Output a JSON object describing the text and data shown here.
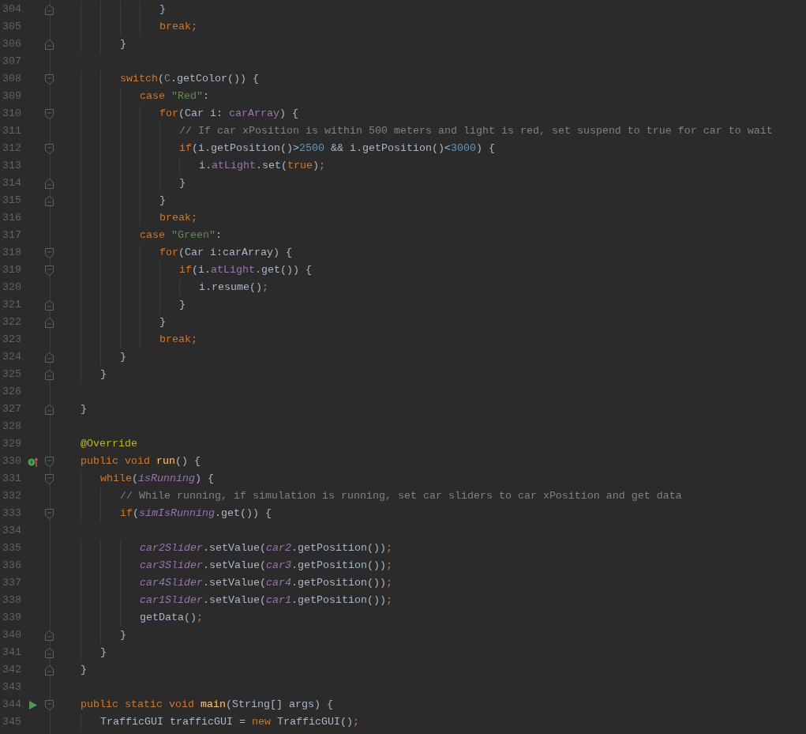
{
  "editor": {
    "lines": [
      {
        "number": "304",
        "fold": {
          "kind": "end"
        },
        "tokens": [
          {
            "kind": "plain",
            "text": "                    }"
          }
        ]
      },
      {
        "number": "305",
        "tokens": [
          {
            "kind": "kw",
            "text": "                    break;"
          }
        ]
      },
      {
        "number": "306",
        "fold": {
          "kind": "end"
        },
        "tokens": [
          {
            "kind": "plain",
            "text": "            }"
          }
        ]
      },
      {
        "number": "307"
      },
      {
        "number": "308",
        "fold": {
          "kind": "start"
        },
        "tokens": [
          {
            "kind": "kw",
            "text": "            switch"
          },
          {
            "kind": "plain",
            "text": "("
          },
          {
            "kind": "field",
            "text": "C"
          },
          {
            "kind": "plain",
            "text": ".getColor()) {"
          }
        ]
      },
      {
        "number": "309",
        "tokens": [
          {
            "kind": "kw",
            "text": "                case "
          },
          {
            "kind": "str",
            "text": "\"Red\""
          },
          {
            "kind": "plain",
            "text": ":"
          }
        ]
      },
      {
        "number": "310",
        "fold": {
          "kind": "start"
        },
        "tokens": [
          {
            "kind": "kw",
            "text": "                    for"
          },
          {
            "kind": "plain",
            "text": "(Car i: "
          },
          {
            "kind": "field",
            "text": "carArray"
          },
          {
            "kind": "plain",
            "text": ") {"
          }
        ]
      },
      {
        "number": "311",
        "tokens": [
          {
            "kind": "comment",
            "text": "                        // If car xPosition is within 500 meters and light is red, set suspend to true for car to wait"
          }
        ]
      },
      {
        "number": "312",
        "fold": {
          "kind": "start"
        },
        "tokens": [
          {
            "kind": "kw",
            "text": "                        if"
          },
          {
            "kind": "plain",
            "text": "(i.getPosition()>"
          },
          {
            "kind": "num",
            "text": "2500"
          },
          {
            "kind": "plain",
            "text": " && i.getPosition()<"
          },
          {
            "kind": "num",
            "text": "3000"
          },
          {
            "kind": "plain",
            "text": ") {"
          }
        ]
      },
      {
        "number": "313",
        "tokens": [
          {
            "kind": "plain",
            "text": "                            i."
          },
          {
            "kind": "field",
            "text": "atLight"
          },
          {
            "kind": "plain",
            "text": ".set("
          },
          {
            "kind": "kw",
            "text": "true"
          },
          {
            "kind": "plain",
            "text": ")"
          },
          {
            "kind": "kw",
            "text": ";"
          }
        ]
      },
      {
        "number": "314",
        "fold": {
          "kind": "end"
        },
        "tokens": [
          {
            "kind": "plain",
            "text": "                        }"
          }
        ]
      },
      {
        "number": "315",
        "fold": {
          "kind": "end"
        },
        "tokens": [
          {
            "kind": "plain",
            "text": "                    }"
          }
        ]
      },
      {
        "number": "316",
        "tokens": [
          {
            "kind": "kw",
            "text": "                    break;"
          }
        ]
      },
      {
        "number": "317",
        "tokens": [
          {
            "kind": "kw",
            "text": "                case "
          },
          {
            "kind": "str",
            "text": "\"Green\""
          },
          {
            "kind": "plain",
            "text": ":"
          }
        ]
      },
      {
        "number": "318",
        "fold": {
          "kind": "start"
        },
        "tokens": [
          {
            "kind": "kw",
            "text": "                    for"
          },
          {
            "kind": "plain",
            "text": "(Car i:carArray) {"
          }
        ]
      },
      {
        "number": "319",
        "fold": {
          "kind": "start"
        },
        "tokens": [
          {
            "kind": "kw",
            "text": "                        if"
          },
          {
            "kind": "plain",
            "text": "(i."
          },
          {
            "kind": "field",
            "text": "atLight"
          },
          {
            "kind": "plain",
            "text": ".get()) {"
          }
        ]
      },
      {
        "number": "320",
        "tokens": [
          {
            "kind": "plain",
            "text": "                            i.resume()"
          },
          {
            "kind": "kw",
            "text": ";"
          }
        ]
      },
      {
        "number": "321",
        "fold": {
          "kind": "end"
        },
        "tokens": [
          {
            "kind": "plain",
            "text": "                        }"
          }
        ]
      },
      {
        "number": "322",
        "fold": {
          "kind": "end"
        },
        "tokens": [
          {
            "kind": "plain",
            "text": "                    }"
          }
        ]
      },
      {
        "number": "323",
        "tokens": [
          {
            "kind": "kw",
            "text": "                    break;"
          }
        ]
      },
      {
        "number": "324",
        "fold": {
          "kind": "end"
        },
        "tokens": [
          {
            "kind": "plain",
            "text": "            }"
          }
        ]
      },
      {
        "number": "325",
        "fold": {
          "kind": "end"
        },
        "tokens": [
          {
            "kind": "plain",
            "text": "        }"
          }
        ]
      },
      {
        "number": "326"
      },
      {
        "number": "327",
        "fold": {
          "kind": "end"
        },
        "tokens": [
          {
            "kind": "plain",
            "text": "    }"
          }
        ]
      },
      {
        "number": "328"
      },
      {
        "number": "329",
        "tokens": [
          {
            "kind": "ann",
            "text": "    @Override"
          }
        ]
      },
      {
        "number": "330",
        "fold": {
          "kind": "start"
        },
        "marker": {
          "kind": "override"
        },
        "tokens": [
          {
            "kind": "kw",
            "text": "    public void "
          },
          {
            "kind": "decl",
            "text": "run"
          },
          {
            "kind": "plain",
            "text": "() {"
          }
        ]
      },
      {
        "number": "331",
        "fold": {
          "kind": "start"
        },
        "tokens": [
          {
            "kind": "kw",
            "text": "        while"
          },
          {
            "kind": "plain",
            "text": "("
          },
          {
            "kind": "static",
            "text": "isRunning"
          },
          {
            "kind": "plain",
            "text": ") {"
          }
        ]
      },
      {
        "number": "332",
        "tokens": [
          {
            "kind": "comment",
            "text": "            // While running, if simulation is running, set car sliders to car xPosition and get data"
          }
        ]
      },
      {
        "number": "333",
        "fold": {
          "kind": "start"
        },
        "tokens": [
          {
            "kind": "kw",
            "text": "            if"
          },
          {
            "kind": "plain",
            "text": "("
          },
          {
            "kind": "static",
            "text": "simIsRunning"
          },
          {
            "kind": "plain",
            "text": ".get()) {"
          }
        ]
      },
      {
        "number": "334"
      },
      {
        "number": "335",
        "tokens": [
          {
            "kind": "static",
            "text": "                car2Slider"
          },
          {
            "kind": "plain",
            "text": ".setValue("
          },
          {
            "kind": "static",
            "text": "car2"
          },
          {
            "kind": "plain",
            "text": ".getPosition())"
          },
          {
            "kind": "kw",
            "text": ";"
          }
        ]
      },
      {
        "number": "336",
        "tokens": [
          {
            "kind": "static",
            "text": "                car3Slider"
          },
          {
            "kind": "plain",
            "text": ".setValue("
          },
          {
            "kind": "static",
            "text": "car3"
          },
          {
            "kind": "plain",
            "text": ".getPosition())"
          },
          {
            "kind": "kw",
            "text": ";"
          }
        ]
      },
      {
        "number": "337",
        "tokens": [
          {
            "kind": "static",
            "text": "                car4Slider"
          },
          {
            "kind": "plain",
            "text": ".setValue("
          },
          {
            "kind": "static",
            "text": "car4"
          },
          {
            "kind": "plain",
            "text": ".getPosition())"
          },
          {
            "kind": "kw",
            "text": ";"
          }
        ]
      },
      {
        "number": "338",
        "tokens": [
          {
            "kind": "static",
            "text": "                car1Slider"
          },
          {
            "kind": "plain",
            "text": ".setValue("
          },
          {
            "kind": "static",
            "text": "car1"
          },
          {
            "kind": "plain",
            "text": ".getPosition())"
          },
          {
            "kind": "kw",
            "text": ";"
          }
        ]
      },
      {
        "number": "339",
        "tokens": [
          {
            "kind": "plain",
            "text": "                getData()"
          },
          {
            "kind": "kw",
            "text": ";"
          }
        ]
      },
      {
        "number": "340",
        "fold": {
          "kind": "end"
        },
        "tokens": [
          {
            "kind": "plain",
            "text": "            }"
          }
        ]
      },
      {
        "number": "341",
        "fold": {
          "kind": "end"
        },
        "tokens": [
          {
            "kind": "plain",
            "text": "        }"
          }
        ]
      },
      {
        "number": "342",
        "fold": {
          "kind": "end"
        },
        "tokens": [
          {
            "kind": "plain",
            "text": "    }"
          }
        ]
      },
      {
        "number": "343"
      },
      {
        "number": "344",
        "fold": {
          "kind": "start"
        },
        "marker": {
          "kind": "run"
        },
        "tokens": [
          {
            "kind": "kw",
            "text": "    public static void "
          },
          {
            "kind": "decl",
            "text": "main"
          },
          {
            "kind": "plain",
            "text": "(String[] args) {"
          }
        ]
      },
      {
        "number": "345",
        "tokens": [
          {
            "kind": "plain",
            "text": "        TrafficGUI trafficGUI = "
          },
          {
            "kind": "kw",
            "text": "new "
          },
          {
            "kind": "plain",
            "text": "TrafficGUI()"
          },
          {
            "kind": "kw",
            "text": ";"
          }
        ]
      }
    ]
  }
}
